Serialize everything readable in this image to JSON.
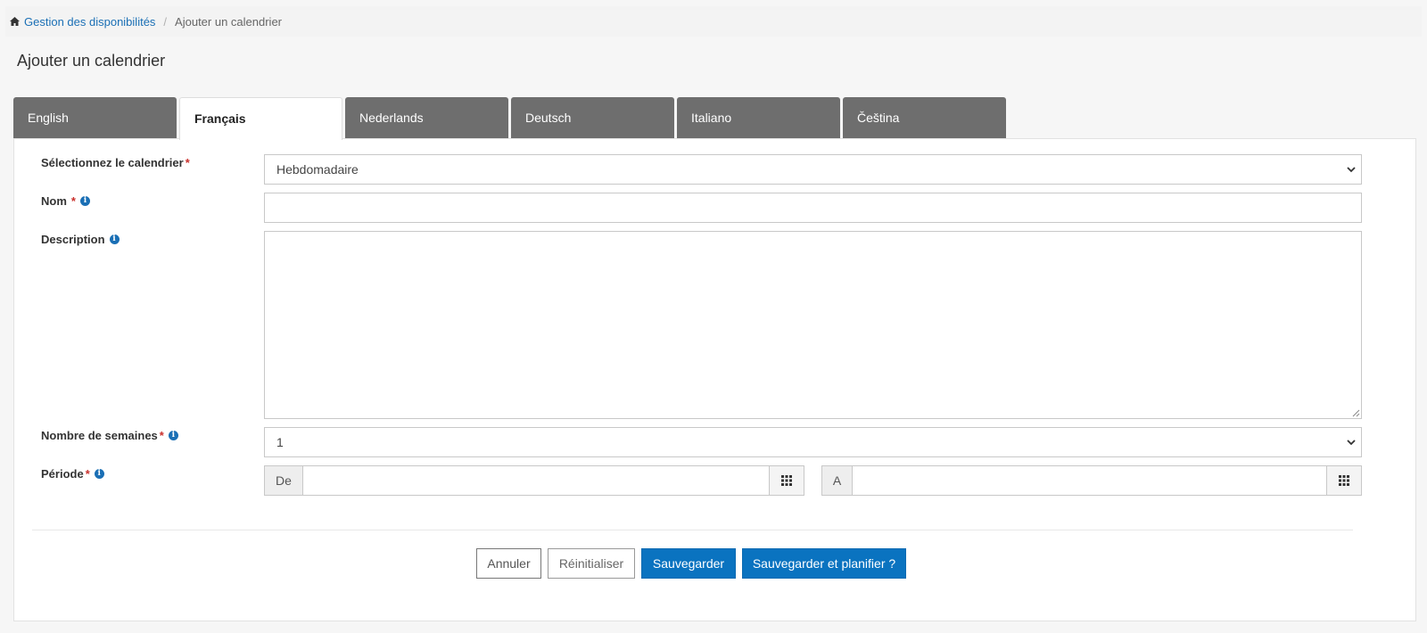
{
  "breadcrumb": {
    "home_label": "Gestion des disponibilités",
    "current": "Ajouter un calendrier",
    "separator": "/"
  },
  "page_title": "Ajouter un calendrier",
  "tabs": [
    {
      "label": "English",
      "active": false
    },
    {
      "label": "Français",
      "active": true
    },
    {
      "label": "Nederlands",
      "active": false
    },
    {
      "label": "Deutsch",
      "active": false
    },
    {
      "label": "Italiano",
      "active": false
    },
    {
      "label": "Čeština",
      "active": false
    }
  ],
  "form": {
    "calendar_select": {
      "label": "Sélectionnez le calendrier",
      "required_mark": "*",
      "value": "Hebdomadaire"
    },
    "name": {
      "label": "Nom",
      "required_mark": "*",
      "value": ""
    },
    "description": {
      "label": "Description",
      "value": ""
    },
    "weeks": {
      "label": "Nombre de semaines",
      "required_mark": "*",
      "value": "1"
    },
    "period": {
      "label": "Période",
      "required_mark": "*",
      "from_prefix": "De",
      "from_value": "",
      "to_prefix": "A",
      "to_value": ""
    },
    "info_glyph": "i"
  },
  "buttons": {
    "cancel": "Annuler",
    "reset": "Réinitialiser",
    "save": "Sauvegarder",
    "save_plan": "Sauvegarder et planifier ?"
  },
  "colors": {
    "accent": "#0a73c0",
    "link": "#1a6fb5",
    "tab_inactive": "#6e6e6e",
    "required": "#c9302c"
  },
  "icons": {
    "home": "home-icon",
    "info": "info-icon",
    "dropdown": "chevron-down-icon",
    "calendar": "calendar-grid-icon"
  }
}
